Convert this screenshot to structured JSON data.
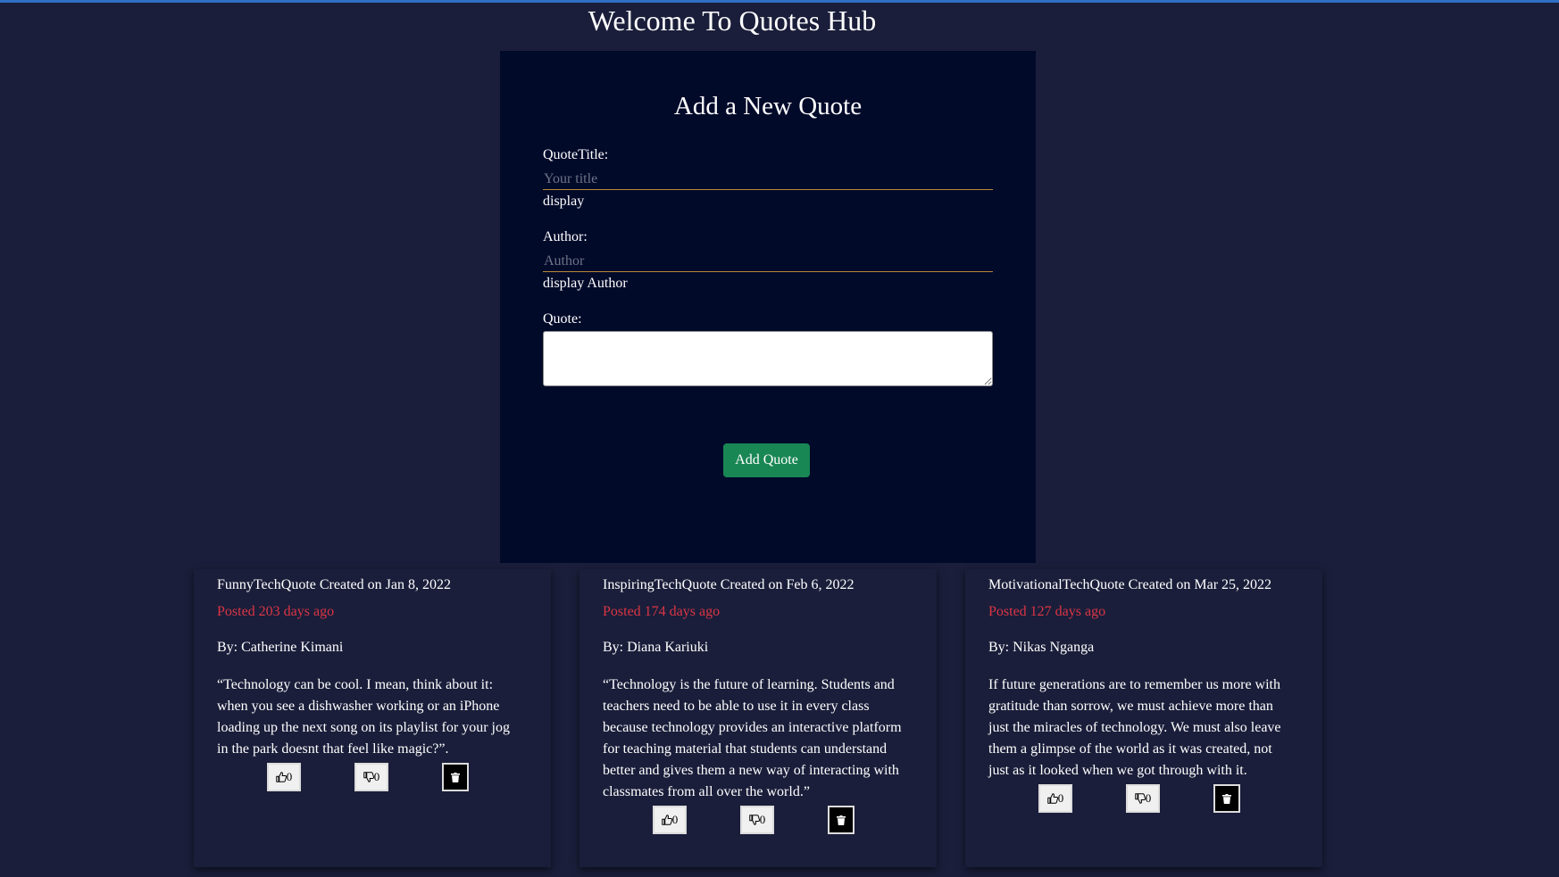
{
  "header": {
    "title": "Welcome To Quotes Hub"
  },
  "form": {
    "heading": "Add a New Quote",
    "title_label": "QuoteTitle:",
    "title_placeholder": "Your title",
    "title_display": "display",
    "author_label": "Author:",
    "author_placeholder": "Author",
    "author_display": "display Author",
    "quote_label": "Quote:",
    "submit_label": "Add Quote"
  },
  "quotes": [
    {
      "title_line": "FunnyTechQuote Created on Jan 8, 2022",
      "posted": "Posted 203 days ago",
      "author": "By: Catherine Kimani",
      "text": "“Technology can be cool. I mean, think about it: when you see a dishwasher working or an iPhone loading up the next song on its playlist for your jog in the park doesnt that feel like magic?”.",
      "upvotes": "0",
      "downvotes": "0"
    },
    {
      "title_line": "InspiringTechQuote Created on Feb 6, 2022",
      "posted": "Posted 174 days ago",
      "author": "By: Diana Kariuki",
      "text": "“Technology is the future of learning. Students and teachers need to be able to use it in every class because technology provides an interactive platform for teaching material that students can understand better and gives them a new way of interacting with classmates from all over the world.”",
      "upvotes": "0",
      "downvotes": "0"
    },
    {
      "title_line": "MotivationalTechQuote Created on Mar 25, 2022",
      "posted": "Posted 127 days ago",
      "author": "By: Nikas Nganga",
      "text": "If future generations are to remember us more with gratitude than sorrow, we must achieve more than just the miracles of technology. We must also leave them a glimpse of the world as it was created, not just as it looked when we got through with it.",
      "upvotes": "0",
      "downvotes": "0"
    }
  ],
  "icons": {
    "upvote": "thumbs-up-icon",
    "downvote": "thumbs-down-icon",
    "delete": "trash-icon"
  },
  "colors": {
    "background": "#1a1e3a",
    "form_background": "#020a2a",
    "accent_green": "#198754",
    "posted_red": "#dc3545",
    "input_underline": "#b8893a",
    "top_line": "#2f6fc4"
  }
}
